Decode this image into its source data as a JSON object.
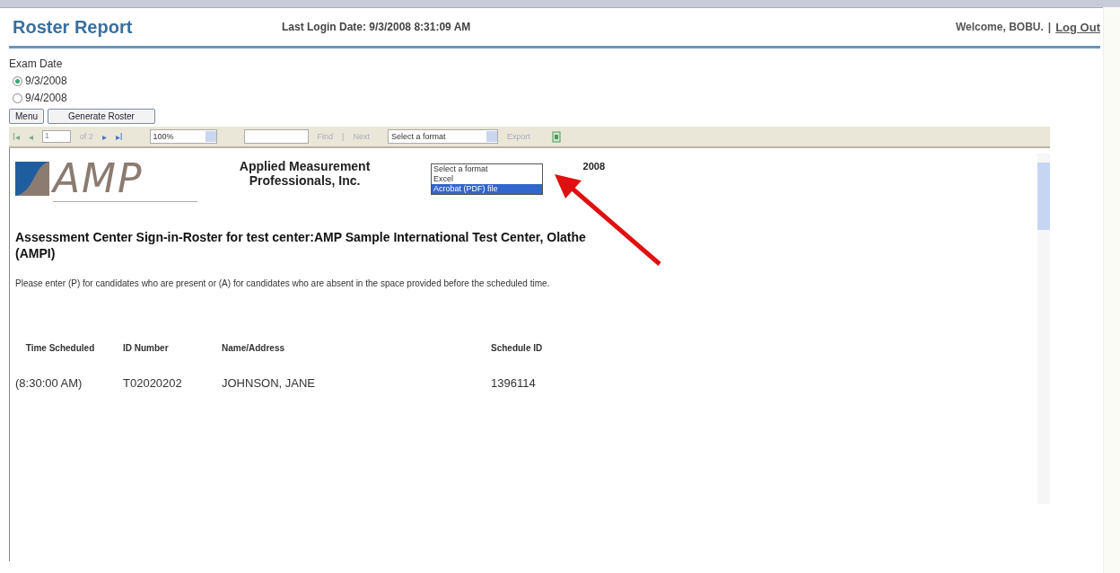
{
  "header": {
    "title": "Roster Report",
    "last_login": "Last Login Date: 9/3/2008 8:31:09 AM",
    "welcome": "Welcome, BOBU.",
    "separator": "|",
    "logout": "Log Out"
  },
  "exam_date": {
    "label": "Exam Date",
    "options": [
      {
        "label": "9/3/2008",
        "selected": true
      },
      {
        "label": "9/4/2008",
        "selected": false
      }
    ]
  },
  "buttons": [
    "Menu",
    "Generate Roster"
  ],
  "toolbar": {
    "first": "I◂",
    "prev": "◂",
    "page": "1",
    "of": "of 2",
    "next": "▸",
    "last": "▸I",
    "zoom": "100%",
    "find": "Find",
    "sep": "|",
    "next_link": "Next",
    "format": "Select a format",
    "export": "Export"
  },
  "format_menu": [
    {
      "label": "Select a format",
      "selected": false
    },
    {
      "label": "Excel",
      "selected": false
    },
    {
      "label": "Acrobat (PDF) file",
      "selected": true
    }
  ],
  "report": {
    "logo_text": "AMP",
    "company": "Applied Measurement Professionals, Inc.",
    "date_fragment": "2008",
    "heading": "Assessment Center Sign-in-Roster for test center:AMP Sample International Test Center, Olathe (AMPI)",
    "instructions": "Please enter (P) for candidates who are present or (A) for candidates who are absent in the space provided before the scheduled time.",
    "columns": [
      "Time Scheduled",
      "ID Number",
      "Name/Address",
      "Schedule ID"
    ],
    "rows": [
      [
        "(8:30:00 AM)",
        "T02020202",
        "JOHNSON, JANE",
        "1396114"
      ]
    ]
  }
}
